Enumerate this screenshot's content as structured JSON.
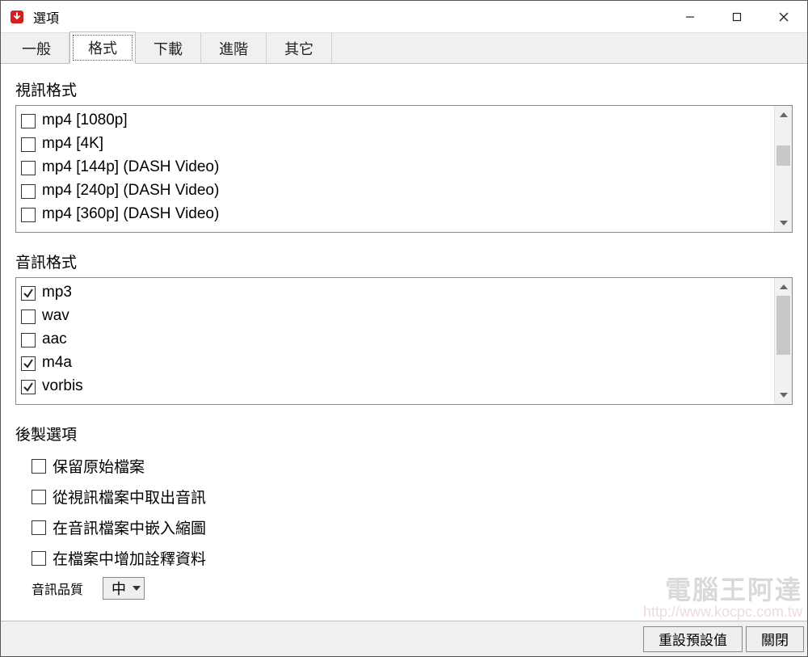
{
  "window": {
    "title": "選項",
    "icon_name": "app-download-icon"
  },
  "tabs": [
    {
      "label": "一般",
      "active": false
    },
    {
      "label": "格式",
      "active": true
    },
    {
      "label": "下載",
      "active": false
    },
    {
      "label": "進階",
      "active": false
    },
    {
      "label": "其它",
      "active": false
    }
  ],
  "video_section": {
    "label": "視訊格式",
    "items": [
      {
        "label": "mp4 [1080p]",
        "checked": false
      },
      {
        "label": "mp4 [4K]",
        "checked": false
      },
      {
        "label": "mp4 [144p] (DASH Video)",
        "checked": false
      },
      {
        "label": "mp4 [240p] (DASH Video)",
        "checked": false
      },
      {
        "label": "mp4 [360p] (DASH Video)",
        "checked": false
      }
    ],
    "scroll_thumb": {
      "top_pct": 24,
      "height_pct": 22
    }
  },
  "audio_section": {
    "label": "音訊格式",
    "items": [
      {
        "label": "mp3",
        "checked": true
      },
      {
        "label": "wav",
        "checked": false
      },
      {
        "label": "aac",
        "checked": false
      },
      {
        "label": "m4a",
        "checked": true
      },
      {
        "label": "vorbis",
        "checked": true
      }
    ],
    "scroll_thumb": {
      "top_pct": 0,
      "height_pct": 65
    }
  },
  "post_options": {
    "label": "後製選項",
    "items": [
      {
        "label": "保留原始檔案",
        "checked": false
      },
      {
        "label": "從視訊檔案中取出音訊",
        "checked": false
      },
      {
        "label": "在音訊檔案中嵌入縮圖",
        "checked": false
      },
      {
        "label": "在檔案中增加詮釋資料",
        "checked": false
      }
    ]
  },
  "audio_quality": {
    "label": "音訊品質",
    "selected": "中"
  },
  "footer": {
    "reset_label": "重設預設值",
    "close_label": "關閉"
  },
  "watermark": {
    "text": "電腦王阿達",
    "url": "http://www.kocpc.com.tw"
  }
}
